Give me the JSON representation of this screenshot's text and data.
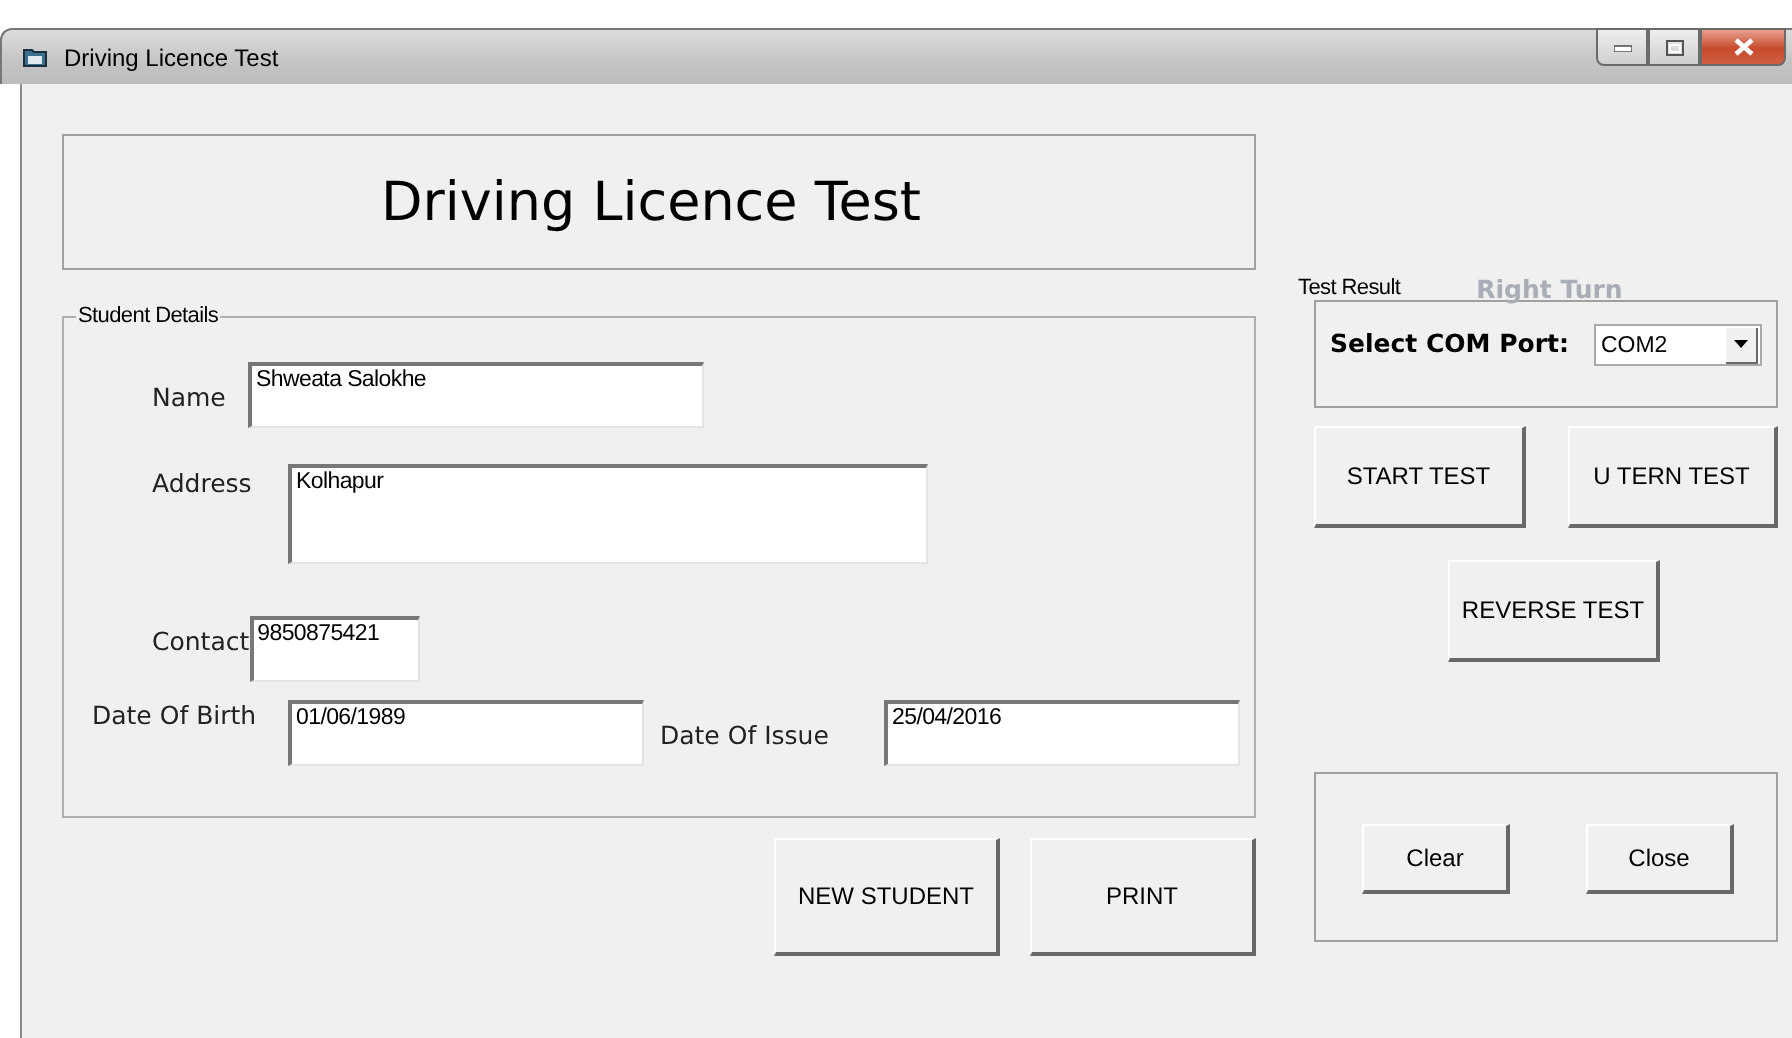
{
  "window": {
    "title": "Driving Licence Test"
  },
  "header": {
    "title": "Driving Licence Test"
  },
  "student_details": {
    "legend": "Student Details",
    "fields": [
      {
        "label": "Name",
        "value": "Shweata Salokhe",
        "kind": "line"
      },
      {
        "label": "Address",
        "value": "Kolhapur",
        "kind": "multiline"
      },
      {
        "label": "Contact",
        "value": "9850875421",
        "kind": "short"
      }
    ],
    "date_of_birth": {
      "label": "Date Of Birth",
      "value": "01/06/1989"
    },
    "date_of_issue": {
      "label": "Date Of Issue",
      "value": "25/04/2016"
    }
  },
  "form_buttons": [
    "NEW STUDENT",
    "PRINT"
  ],
  "test_result": {
    "label": "Test Result",
    "value": "Right Turn"
  },
  "com_port": {
    "label": "Select COM Port:",
    "value": "COM2"
  },
  "test_buttons": [
    "START TEST",
    "U TERN TEST"
  ],
  "reverse_button": "REVERSE TEST",
  "bottom_buttons": [
    "Clear",
    "Close"
  ]
}
